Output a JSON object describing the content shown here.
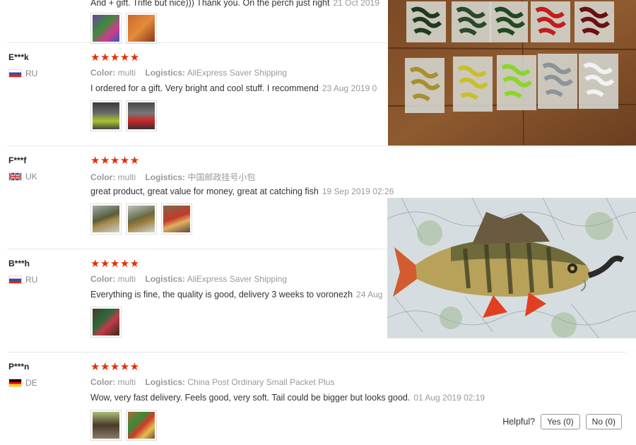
{
  "top_review": {
    "text": "And + gift. Trifle but nice))) Thank you. On the perch just right",
    "date": "21 Oct 2019"
  },
  "labels": {
    "color": "Color:",
    "logistics": "Logistics:"
  },
  "reviews": [
    {
      "user": "E***k",
      "country": "RU",
      "color": "multi",
      "logistics": "AliExpress Saver Shipping",
      "text": "I ordered for a gift. Very bright and cool stuff. I recommend",
      "date": "23 Aug 2019 0"
    },
    {
      "user": "F***f",
      "country": "UK",
      "color": "multi",
      "logistics": "中国邮政挂号小包",
      "text": "great product, great value for money, great at catching fish",
      "date": "19 Sep 2019 02:26"
    },
    {
      "user": "B***h",
      "country": "RU",
      "color": "multi",
      "logistics": "AliExpress Saver Shipping",
      "text": "Everything is fine, the quality is good, delivery 3 weeks to voronezh",
      "date": "24 Aug"
    },
    {
      "user": "P***n",
      "country": "DE",
      "color": "multi",
      "logistics": "China Post Ordinary Small Packet Plus",
      "text": "Wow, very fast delivery. Feels good, very soft. Tail could be bigger but looks good.",
      "date": "01 Aug 2019 02:19"
    }
  ],
  "stars": "★★★★★",
  "helpful": {
    "label": "Helpful?",
    "yes": "Yes (0)",
    "no": "No (0)"
  }
}
